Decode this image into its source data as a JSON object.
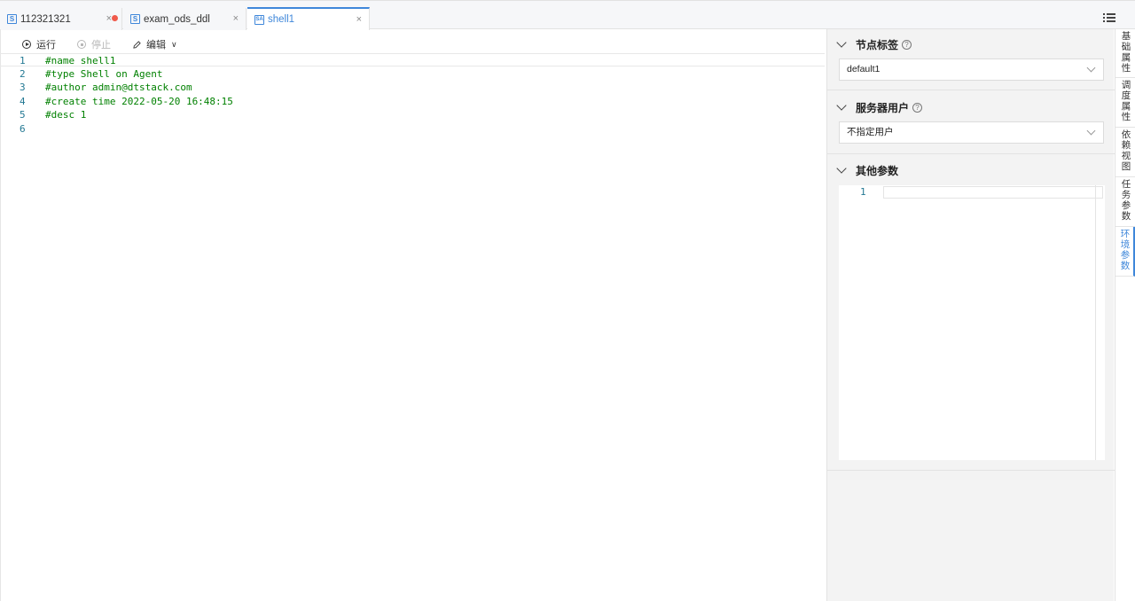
{
  "tabs": [
    {
      "icon": "S",
      "label": "112321321",
      "close": "×",
      "modified": true
    },
    {
      "icon": "S",
      "label": "exam_ods_ddl",
      "close": "×",
      "modified": false
    },
    {
      "icon": "SA",
      "label": "shell1",
      "close": "×",
      "modified": false
    }
  ],
  "active_tab": "shell1",
  "toolbar": {
    "run_label": "运行",
    "stop_label": "停止",
    "edit_label": "编辑"
  },
  "editor": {
    "lines": [
      {
        "num": "1",
        "code": "#name shell1"
      },
      {
        "num": "2",
        "code": "#type Shell on Agent"
      },
      {
        "num": "3",
        "code": "#author admin@dtstack.com"
      },
      {
        "num": "4",
        "code": "#create time 2022-05-20 16:48:15"
      },
      {
        "num": "5",
        "code": "#desc 1"
      },
      {
        "num": "6",
        "code": ""
      }
    ]
  },
  "panel": {
    "node_label": {
      "title": "节点标签",
      "help": "?",
      "value": "default1"
    },
    "server_user": {
      "title": "服务器用户",
      "help": "?",
      "value": "不指定用户"
    },
    "other_params": {
      "title": "其他参数",
      "line_num": "1"
    }
  },
  "side_tabs": [
    {
      "chars": [
        "基",
        "础",
        "属",
        "性"
      ]
    },
    {
      "chars": [
        "调",
        "度",
        "属",
        "性"
      ]
    },
    {
      "chars": [
        "依",
        "赖",
        "视",
        "图"
      ]
    },
    {
      "chars": [
        "任",
        "务",
        "参",
        "数"
      ]
    },
    {
      "chars": [
        "环",
        "境",
        "参",
        "数"
      ]
    }
  ],
  "colors": {
    "accent": "#3f87da",
    "modified_dot": "#f05a4b",
    "code": "#008000",
    "line_number": "#237893"
  }
}
